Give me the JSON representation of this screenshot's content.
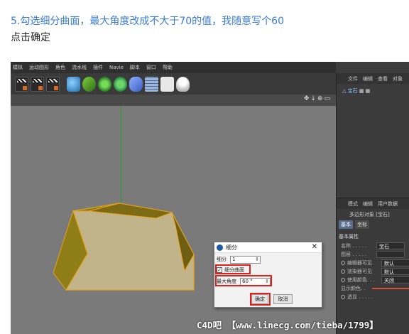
{
  "article": {
    "step_text": "5.勾选细分曲面，最大角度改成不大于70的值，我随意写个60",
    "click_text": "点击确定"
  },
  "menubar": [
    "模拟",
    "运动图形",
    "角色",
    "流水线",
    "插件",
    "Navie",
    "脚本",
    "窗口",
    "帮助"
  ],
  "toolbar_icons": [
    "render-region-icon",
    "render-view-icon",
    "render-settings-icon",
    "cube-icon",
    "pen-icon",
    "subdivision-icon",
    "array-icon",
    "deformer-icon",
    "floor-icon",
    "camera-icon",
    "light-icon"
  ],
  "viewport": {
    "nav_icons": "✥↓⊕▭"
  },
  "object_manager": {
    "tabs": [
      "文件",
      "编辑",
      "查看",
      "对象"
    ],
    "object_name": "宝石"
  },
  "attribute_manager": {
    "tabs": [
      "模式",
      "编辑",
      "用户数据"
    ],
    "object_title": "多边形对象 [宝石]",
    "subtabs": [
      "基本",
      "坐标"
    ],
    "section": "基本属性",
    "props": [
      {
        "label": "名称 . . . . .",
        "value": "宝石"
      },
      {
        "label": "图层 . . . . .",
        "value": ""
      },
      {
        "label": "编辑器可见",
        "value": "默认"
      },
      {
        "label": "渲染器可见",
        "value": "默认"
      },
      {
        "label": "使用颜色. . .",
        "value": "关闭"
      },
      {
        "label": "显示颜色. .",
        "value": ""
      },
      {
        "label": "透显 . . . . .",
        "value": ""
      }
    ]
  },
  "dialog": {
    "title": "细分",
    "subdivision_label": "细分",
    "subdivision_value": "1",
    "subdivision_surface_label": "细分曲面",
    "subdivision_surface_checked": true,
    "max_angle_label": "最大角度",
    "max_angle_value": "60 °",
    "ok_label": "确定",
    "cancel_label": "取消"
  },
  "watermark": "C4D吧 【www.linecg.com/tieba/1799】",
  "colors": {
    "accent_red": "#e0201a",
    "gem_face": "#c2b48a",
    "gem_edge": "#e8a21a",
    "link_blue": "#3a7bd5"
  }
}
